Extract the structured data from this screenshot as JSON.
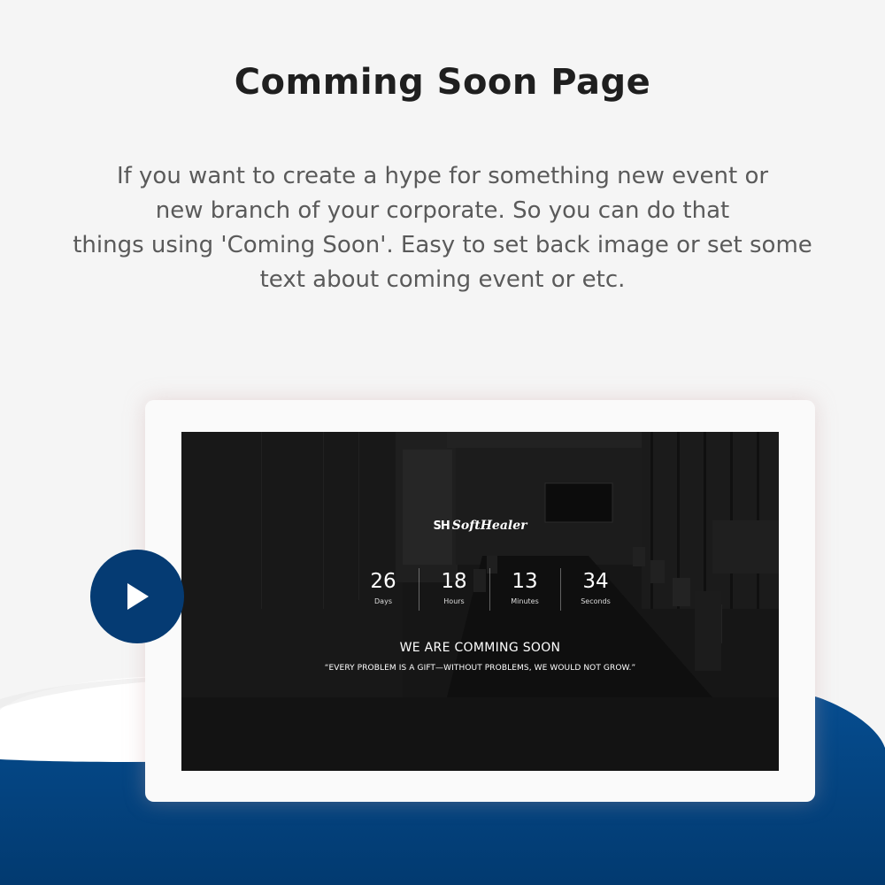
{
  "header": {
    "title": "Comming Soon Page"
  },
  "description": {
    "lines": [
      "If you want to create a hype for something new event or",
      "new branch of your corporate. So you can do that",
      "things using 'Coming Soon'. Easy to set back image or set some",
      "text about coming event or etc."
    ]
  },
  "preview": {
    "logo_text": "SoftHealer",
    "logo_mark": "SH",
    "countdown": [
      {
        "value": "26",
        "label": "Days"
      },
      {
        "value": "18",
        "label": "Hours"
      },
      {
        "value": "13",
        "label": "Minutes"
      },
      {
        "value": "34",
        "label": "Seconds"
      }
    ],
    "headline": "WE ARE COMMING SOON",
    "quote": "“EVERY PROBLEM IS A GIFT—WITHOUT PROBLEMS, WE WOULD NOT GROW.”"
  },
  "play_button": {
    "icon": "play-icon"
  },
  "colors": {
    "accent_blue": "#053b73",
    "wave_blue": "#03457f",
    "background": "#f5f5f5",
    "title_text": "#1f1f1f",
    "body_text": "#5a5a5a"
  }
}
